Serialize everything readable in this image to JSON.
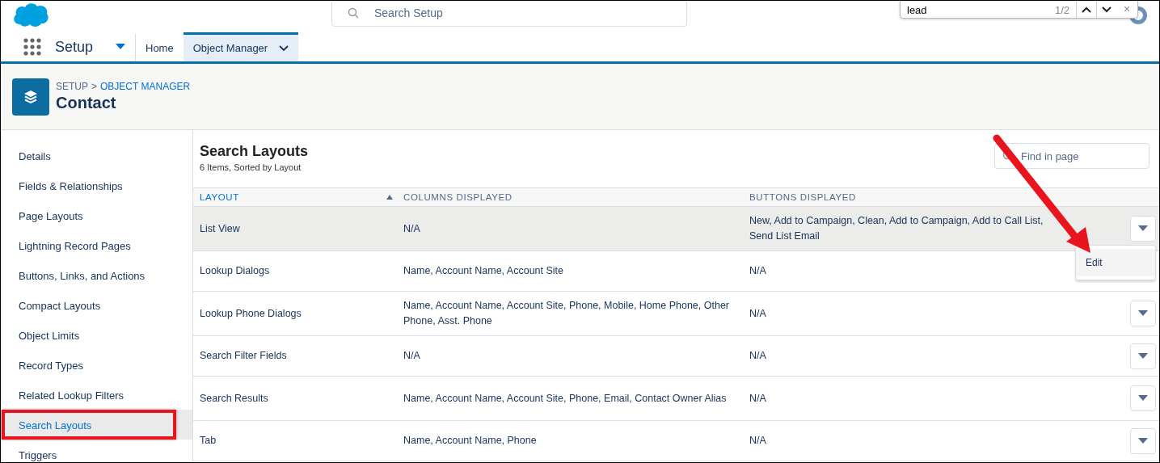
{
  "header": {
    "search": {
      "placeholder": "Search Setup"
    },
    "find_bar": {
      "value": "lead",
      "count": "1/2",
      "close": "×"
    }
  },
  "nav": {
    "app_name": "Setup",
    "tabs": [
      {
        "label": "Home",
        "selected": false,
        "menu": false
      },
      {
        "label": "Object Manager",
        "selected": true,
        "menu": true
      }
    ]
  },
  "page_header": {
    "breadcrumb": [
      {
        "label": "SETUP",
        "link": false
      },
      {
        "label": ">",
        "link": false
      },
      {
        "label": "OBJECT MANAGER",
        "link": true
      }
    ],
    "title": "Contact"
  },
  "sidebar": {
    "items": [
      {
        "label": "Details",
        "selected": false,
        "highlighted": false
      },
      {
        "label": "Fields & Relationships",
        "selected": false,
        "highlighted": false
      },
      {
        "label": "Page Layouts",
        "selected": false,
        "highlighted": false
      },
      {
        "label": "Lightning Record Pages",
        "selected": false,
        "highlighted": false
      },
      {
        "label": "Buttons, Links, and Actions",
        "selected": false,
        "highlighted": false
      },
      {
        "label": "Compact Layouts",
        "selected": false,
        "highlighted": false
      },
      {
        "label": "Object Limits",
        "selected": false,
        "highlighted": false
      },
      {
        "label": "Record Types",
        "selected": false,
        "highlighted": false
      },
      {
        "label": "Related Lookup Filters",
        "selected": false,
        "highlighted": false
      },
      {
        "label": "Search Layouts",
        "selected": true,
        "highlighted": true
      },
      {
        "label": "Triggers",
        "selected": false,
        "highlighted": false
      }
    ]
  },
  "main": {
    "title": "Search Layouts",
    "subtitle": "6 Items, Sorted by Layout",
    "find": {
      "placeholder": "Find in page"
    },
    "table": {
      "columns": [
        {
          "label": "LAYOUT",
          "sorted": true
        },
        {
          "label": "COLUMNS DISPLAYED",
          "sorted": false
        },
        {
          "label": "BUTTONS DISPLAYED",
          "sorted": false
        }
      ],
      "rows": [
        {
          "cells": [
            "List View",
            "N/A",
            "New, Add to Campaign, Clean, Add to Campaign, Add to Call List, Send List Email"
          ],
          "selected": true,
          "action_button": true
        },
        {
          "cells": [
            "Lookup Dialogs",
            "Name, Account Name, Account Site",
            "N/A"
          ],
          "selected": false,
          "action_button": false
        },
        {
          "cells": [
            "Lookup Phone Dialogs",
            "Name, Account Name, Account Site, Phone, Mobile, Home Phone, Other Phone, Asst. Phone",
            "N/A"
          ],
          "selected": false,
          "action_button": true
        },
        {
          "cells": [
            "Search Filter Fields",
            "N/A",
            "N/A"
          ],
          "selected": false,
          "action_button": true
        },
        {
          "cells": [
            "Search Results",
            "Name, Account Name, Account Site, Phone, Email, Contact Owner Alias",
            "N/A"
          ],
          "selected": false,
          "action_button": true
        },
        {
          "cells": [
            "Tab",
            "Name, Account Name, Phone",
            "N/A"
          ],
          "selected": false,
          "action_button": true
        }
      ]
    },
    "row_menu": {
      "items": [
        "Edit"
      ]
    }
  }
}
